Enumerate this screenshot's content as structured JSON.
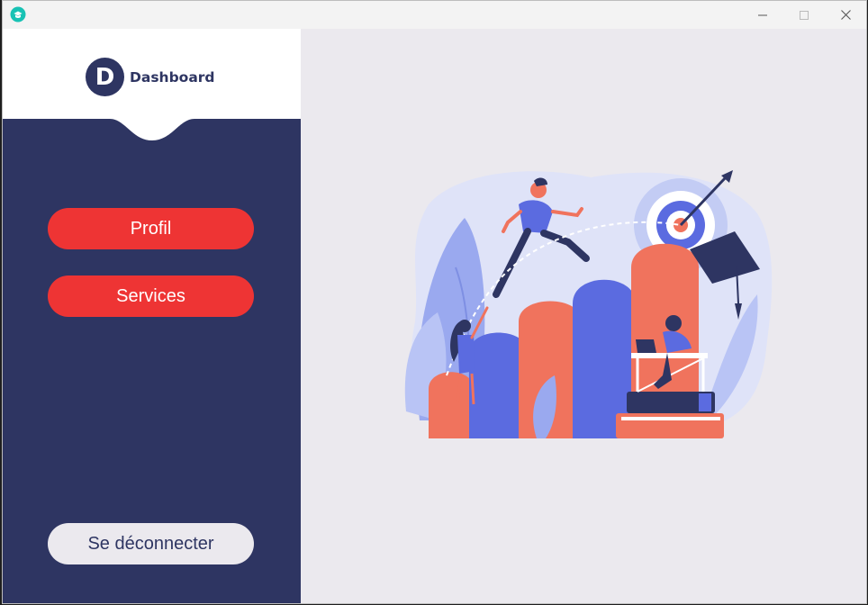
{
  "window": {
    "icon": "app-logo-icon",
    "controls": {
      "minimize": "minimize-icon",
      "maximize": "maximize-icon",
      "close": "close-icon"
    }
  },
  "sidebar": {
    "logo_letter": "D",
    "logo_text": "Dashboard",
    "nav": [
      {
        "label": "Profil"
      },
      {
        "label": "Services"
      }
    ],
    "logout_label": "Se déconnecter"
  },
  "colors": {
    "sidebar_bg": "#2e3562",
    "accent_red": "#ee3434",
    "main_bg": "#ebe9ee",
    "header_bg": "#ffffff"
  },
  "main": {
    "illustration": "education-success-illustration"
  }
}
